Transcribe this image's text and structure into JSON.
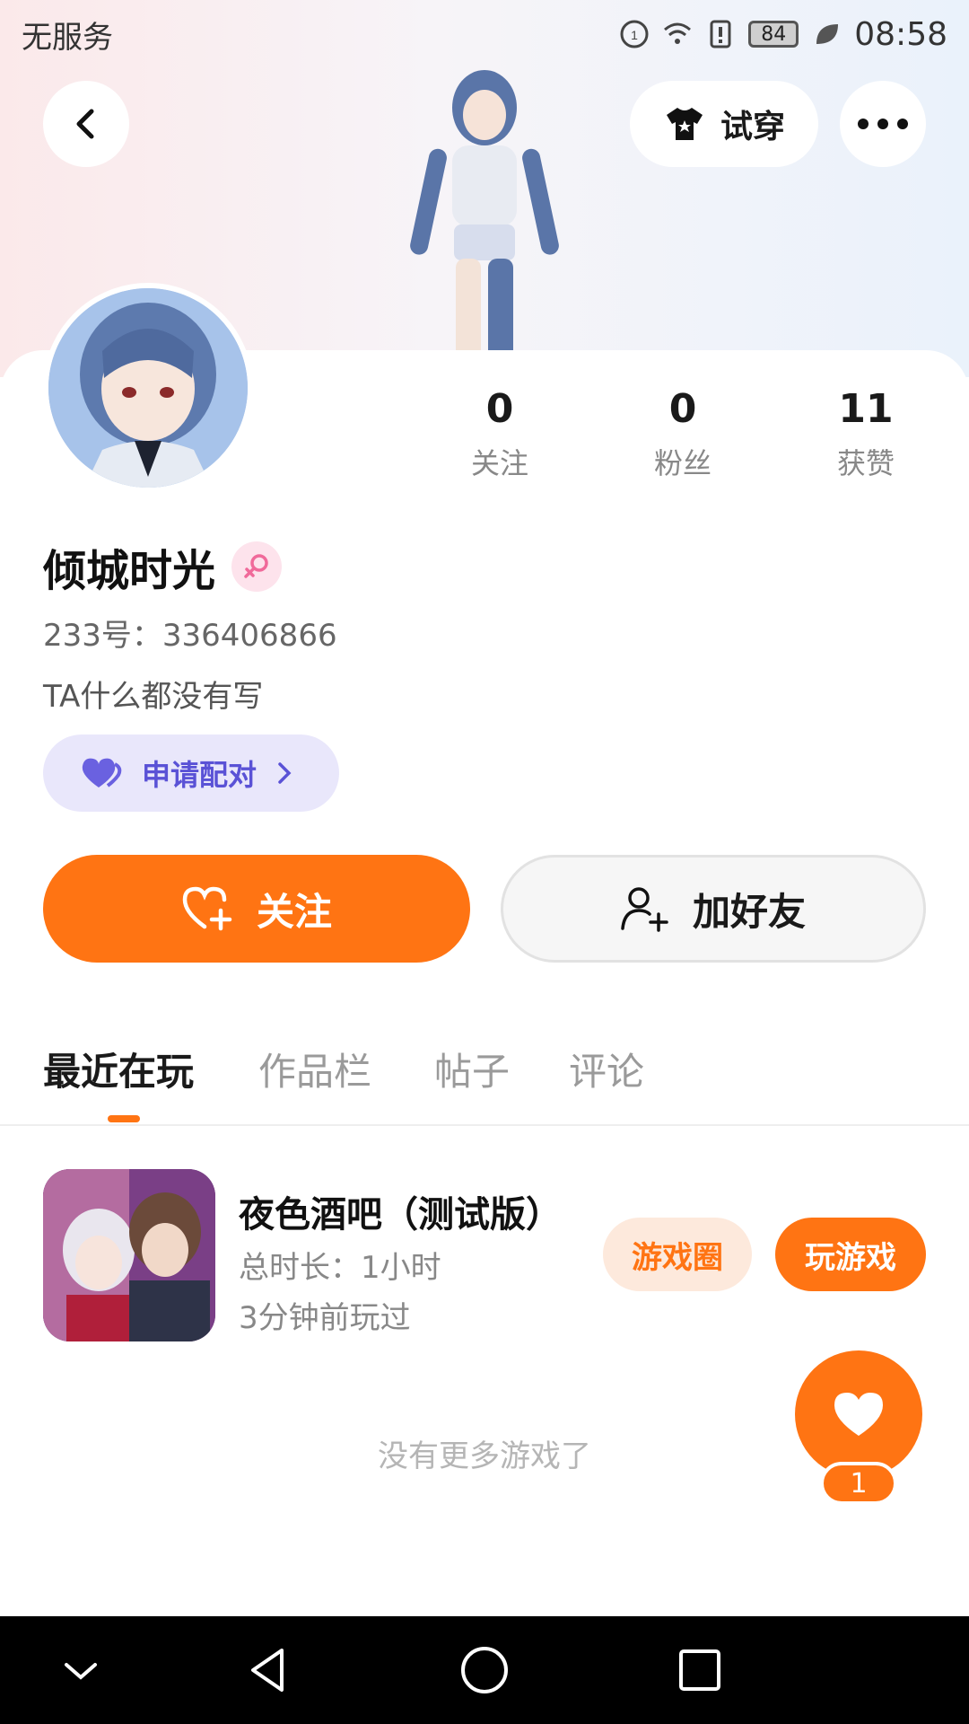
{
  "status_bar": {
    "carrier": "无服务",
    "battery": "84",
    "time": "08:58"
  },
  "header": {
    "try_on_label": "试穿"
  },
  "profile": {
    "stats": [
      {
        "value": "0",
        "label": "关注"
      },
      {
        "value": "0",
        "label": "粉丝"
      },
      {
        "value": "11",
        "label": "获赞"
      }
    ],
    "nickname": "倾城时光",
    "gender": "female",
    "uid": "233号：336406866",
    "bio": "TA什么都没有写",
    "pair_label": "申请配对",
    "follow_label": "关注",
    "add_friend_label": "加好友"
  },
  "tabs": [
    {
      "label": "最近在玩",
      "active": true
    },
    {
      "label": "作品栏",
      "active": false
    },
    {
      "label": "帖子",
      "active": false
    },
    {
      "label": "评论",
      "active": false
    }
  ],
  "recent_game": {
    "title": "夜色酒吧（测试版）",
    "total_time": "总时长：1小时",
    "last_played": "3分钟前玩过",
    "circle_label": "游戏圈",
    "play_label": "玩游戏"
  },
  "empty_hint": "没有更多游戏了",
  "like": {
    "count": "1"
  },
  "colors": {
    "accent": "#ff7413",
    "pair_bg": "#e9e7fb",
    "pair_text": "#5a52d6"
  },
  "icons": [
    "back-icon",
    "shirt-icon",
    "more-icon",
    "female-icon",
    "heart-icon",
    "add-user-icon",
    "nav-collapse-icon",
    "nav-back-icon",
    "nav-home-icon",
    "nav-recent-icon"
  ]
}
